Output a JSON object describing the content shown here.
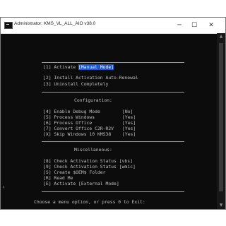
{
  "window": {
    "title": "Administrator: KMS_VL_ALL_AIO v38.0",
    "controls": {
      "minimize": "─",
      "maximize": "☐",
      "close": "✕"
    }
  },
  "menu": {
    "activate": {
      "key": "[1]",
      "label": "Activate",
      "mode": "[Manual Mode]"
    },
    "install_auto_renewal": "[2] Install Activation Auto-Renewal",
    "uninstall_completely": "[3] Uninstall Completely",
    "configuration_header": "Configuration:",
    "config": [
      {
        "label": "[4] Enable Debug Mode",
        "value": "[No]"
      },
      {
        "label": "[5] Process Windows",
        "value": "[Yes]"
      },
      {
        "label": "[6] Process Office",
        "value": "[Yes]"
      },
      {
        "label": "[7] Convert Office C2R-R2V",
        "value": "[Yes]"
      },
      {
        "label": "[X] Skip Windows 10 KMS38",
        "value": "[Yes]"
      }
    ],
    "misc_header": "Miscellaneous:",
    "misc": [
      "[8] Check Activation Status [vbs]",
      "[9] Check Activation Status [wmic]",
      "[S] Create $OEM$ Folder",
      "[R] Read Me",
      "[E] Activate [External Mode]"
    ],
    "prompt": "Choose a menu option, or press 0 to Exit:"
  },
  "scrollbar": {
    "up_arrow": "▲",
    "down_arrow": "▼"
  },
  "left_marker": "›"
}
